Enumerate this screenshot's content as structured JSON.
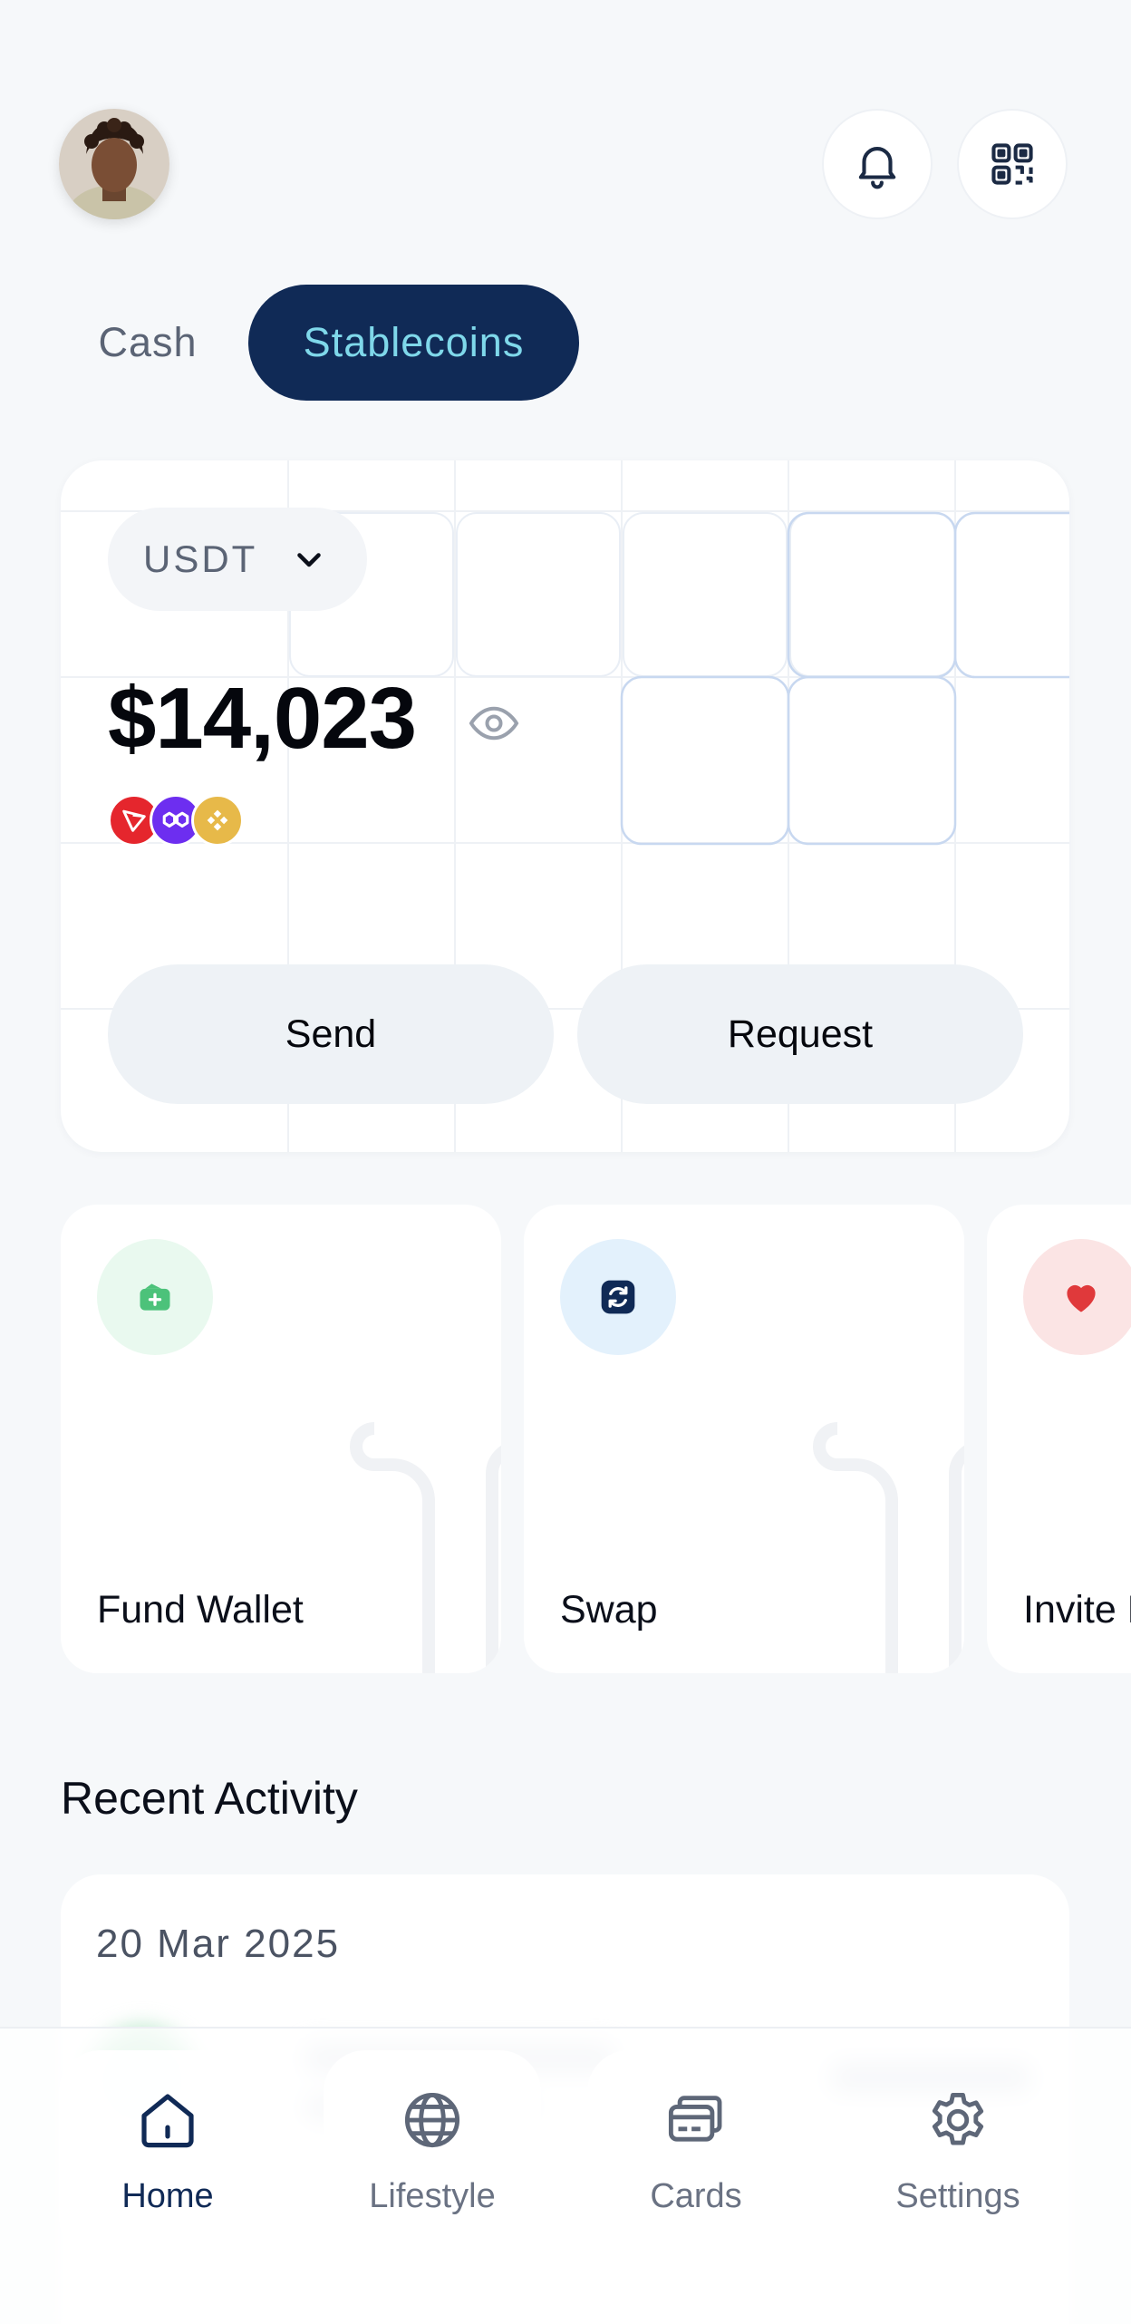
{
  "header": {
    "avatar_alt": "profile-photo",
    "notifications_icon": "bell-icon",
    "qr_icon": "qr-code-icon"
  },
  "tabs": [
    {
      "label": "Cash",
      "active": false
    },
    {
      "label": "Stablecoins",
      "active": true
    }
  ],
  "balance_card": {
    "currency": "USDT",
    "amount": "$14,023",
    "networks": [
      "tron-icon",
      "polygon-icon",
      "bnb-icon"
    ],
    "send_label": "Send",
    "request_label": "Request"
  },
  "quick_actions": [
    {
      "label": "Fund Wallet",
      "icon": "wallet-plus-icon"
    },
    {
      "label": "Swap",
      "icon": "swap-icon"
    },
    {
      "label": "Invite Friends",
      "icon": "heart-icon"
    }
  ],
  "recent_activity": {
    "title": "Recent Activity",
    "date": "20 Mar 2025"
  },
  "bottom_nav": [
    {
      "label": "Home",
      "icon": "home-icon",
      "active": true
    },
    {
      "label": "Lifestyle",
      "icon": "globe-icon",
      "active": false
    },
    {
      "label": "Cards",
      "icon": "cards-icon",
      "active": false
    },
    {
      "label": "Settings",
      "icon": "settings-icon",
      "active": false
    }
  ],
  "colors": {
    "primary_navy": "#102a56",
    "tab_text_active": "#7fd8ea",
    "background": "#f6f8fa"
  }
}
